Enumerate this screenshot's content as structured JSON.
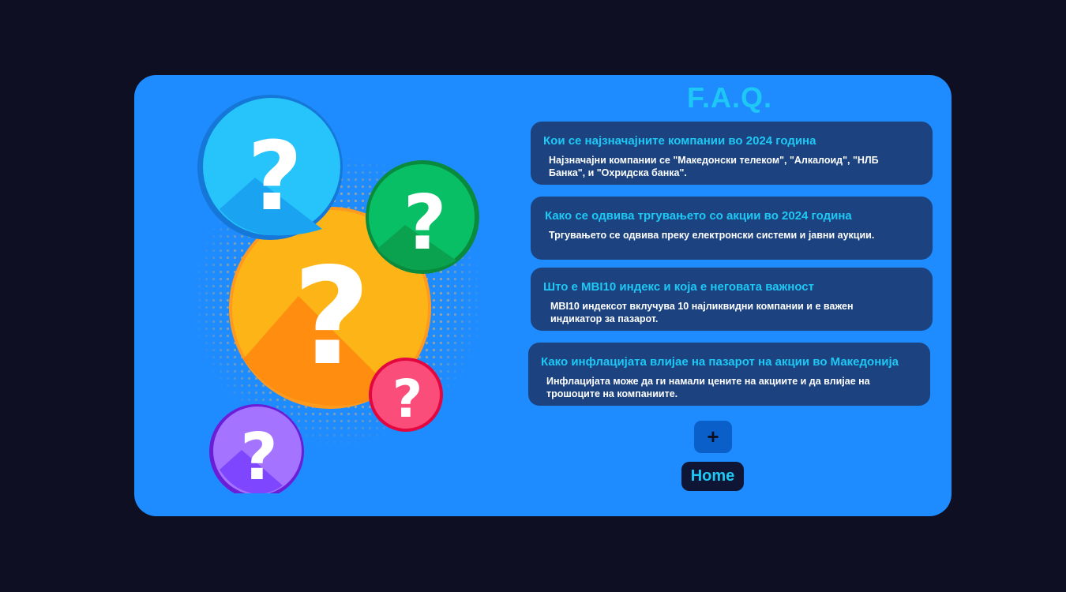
{
  "page": {
    "title": "F.A.Q.",
    "colors": {
      "background": "#0e0f22",
      "card": "#1e8cff",
      "item": "#1c4380",
      "accent": "#1ec8f5",
      "text": "#ffffff"
    }
  },
  "illustration": {
    "icon": "question-marks-illustration",
    "bubbles": [
      {
        "name": "blue-question-icon",
        "color": "#26c4fb"
      },
      {
        "name": "green-question-icon",
        "color": "#0bbf64"
      },
      {
        "name": "orange-question-icon",
        "color": "#fbad18"
      },
      {
        "name": "pink-question-icon",
        "color": "#f7416e"
      },
      {
        "name": "purple-question-icon",
        "color": "#a06cff"
      }
    ]
  },
  "faq": [
    {
      "question": "Кои се најзначајните компании во 2024 година",
      "answer": "Најзначајни компании се \"Македонски телеком\", \"Алкалоид\", \"НЛБ Банка\", и \"Охридска банка\"."
    },
    {
      "question": "Како се одвива тргувањето со акции во 2024 година",
      "answer": "Тргувањето се одвива преку електронски системи и јавни аукции."
    },
    {
      "question": "Што е MBI10 индекс и која е неговата важност",
      "answer": "MBI10 индексот вклучува 10 најликвидни компании и е важен индикатор за пазарот."
    },
    {
      "question": "Како инфлацијата влијае на пазарот на акции во Македонија",
      "answer": "Инфлацијата може да ги намали цените на акциите и да влијае на трошоците на компаниите."
    }
  ],
  "actions": {
    "add_label": "+",
    "home_label": "Home"
  }
}
